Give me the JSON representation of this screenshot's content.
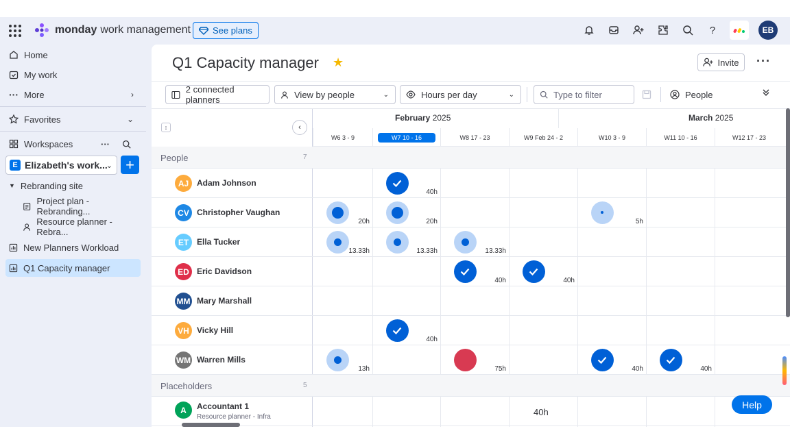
{
  "topbar": {
    "brand": "monday",
    "product": "work management",
    "see_plans": "See plans",
    "user_initials": "EB",
    "icons": [
      "bell-icon",
      "inbox-icon",
      "invite-members-icon",
      "apps-icon",
      "search-icon",
      "help-icon"
    ]
  },
  "sidebar": {
    "home": "Home",
    "my_work": "My work",
    "more": "More",
    "favorites": "Favorites",
    "workspaces": "Workspaces",
    "workspace_badge": "E",
    "workspace_name": "Elizabeth's work...",
    "folder": "Rebranding site",
    "items": [
      {
        "label": "Project plan - Rebranding..."
      },
      {
        "label": "Resource planner - Rebra..."
      },
      {
        "label": "New Planners Workload"
      },
      {
        "label": "Q1 Capacity manager"
      }
    ]
  },
  "header": {
    "title": "Q1 Capacity manager",
    "invite": "Invite"
  },
  "toolbar": {
    "connected": "2 connected planners",
    "view_by": "View by people",
    "hours": "Hours per day",
    "filter_placeholder": "Type to filter",
    "people": "People"
  },
  "timeline": {
    "months": [
      {
        "bold": "February",
        "year": "2025"
      },
      {
        "bold": "March",
        "year": "2025"
      }
    ],
    "weeks": [
      "W6 3 - 9",
      "W7 10 - 16",
      "W8 17 - 23",
      "W9 Feb 24 - 2",
      "W10 3 - 9",
      "W11 10 - 16",
      "W12 17 - 23"
    ],
    "current_week": 1
  },
  "groups": {
    "people": {
      "name": "People",
      "count": "7"
    },
    "placeholders": {
      "name": "Placeholders",
      "count": "5"
    }
  },
  "people": [
    {
      "initials": "AJ",
      "name": "Adam Johnson",
      "color": "#fdab3d",
      "cells": [
        {
          "week": 1,
          "kind": "full",
          "hours": "40h"
        }
      ]
    },
    {
      "initials": "CV",
      "name": "Christopher Vaughan",
      "color": "#1e88e5",
      "cells": [
        {
          "week": 0,
          "kind": "partial-large",
          "hours": "20h"
        },
        {
          "week": 1,
          "kind": "partial-large",
          "hours": "20h"
        },
        {
          "week": 4,
          "kind": "partial-tiny",
          "hours": "5h"
        }
      ]
    },
    {
      "initials": "ET",
      "name": "Ella Tucker",
      "color": "#66ccff",
      "cells": [
        {
          "week": 0,
          "kind": "partial-medium",
          "hours": "13.33h"
        },
        {
          "week": 1,
          "kind": "partial-medium",
          "hours": "13.33h"
        },
        {
          "week": 2,
          "kind": "partial-medium",
          "hours": "13.33h"
        }
      ]
    },
    {
      "initials": "ED",
      "name": "Eric Davidson",
      "color": "#df2f4a",
      "cells": [
        {
          "week": 2,
          "kind": "full",
          "hours": "40h"
        },
        {
          "week": 3,
          "kind": "full",
          "hours": "40h"
        }
      ]
    },
    {
      "initials": "MM",
      "name": "Mary Marshall",
      "color": "#225091",
      "cells": []
    },
    {
      "initials": "VH",
      "name": "Vicky Hill",
      "color": "#fdab3d",
      "cells": [
        {
          "week": 1,
          "kind": "full",
          "hours": "40h"
        }
      ]
    },
    {
      "initials": "WM",
      "name": "Warren Mills",
      "color": "#757575",
      "cells": [
        {
          "week": 0,
          "kind": "partial-medium",
          "hours": "13h"
        },
        {
          "week": 2,
          "kind": "over",
          "hours": "75h"
        },
        {
          "week": 4,
          "kind": "full",
          "hours": "40h"
        },
        {
          "week": 5,
          "kind": "full",
          "hours": "40h"
        }
      ]
    }
  ],
  "placeholders": [
    {
      "initials": "A",
      "name": "Accountant 1",
      "sub": "Resource planner - Infra",
      "color": "#00a359",
      "hours": "40h"
    }
  ],
  "help": "Help"
}
